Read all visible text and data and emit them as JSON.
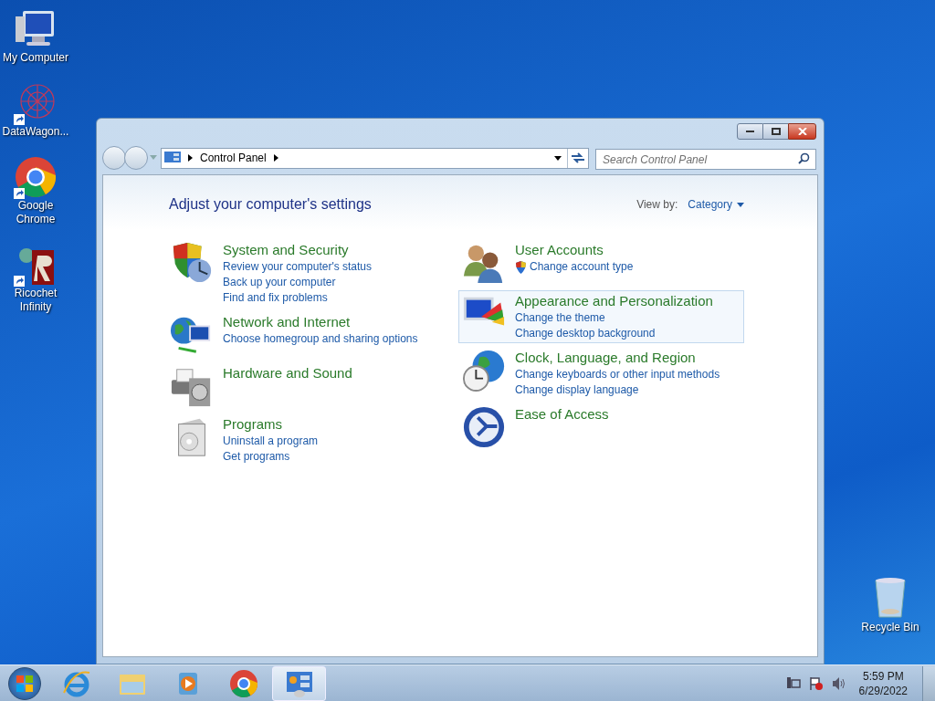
{
  "desktop_icons": [
    {
      "kind": "computer",
      "label": "My Computer",
      "shortcut": false
    },
    {
      "kind": "web",
      "label": "DataWagon...",
      "shortcut": true
    },
    {
      "kind": "browser",
      "label": "Google Chrome",
      "shortcut": true
    },
    {
      "kind": "game",
      "label": "Ricochet Infinity",
      "shortcut": true
    }
  ],
  "recycle_bin": {
    "label": "Recycle Bin"
  },
  "window": {
    "address": "Control Panel",
    "search": {
      "placeholder": "Search Control Panel"
    },
    "heading": "Adjust your computer's settings",
    "view_by": {
      "label": "View by:",
      "value": "Category"
    },
    "columns": [
      [
        {
          "kind": "security",
          "title": "System and Security",
          "hovered": false,
          "links": [
            {
              "text": "Review your computer's status",
              "shield": false
            },
            {
              "text": "Back up your computer",
              "shield": false
            },
            {
              "text": "Find and fix problems",
              "shield": false
            }
          ]
        },
        {
          "kind": "network",
          "title": "Network and Internet",
          "hovered": false,
          "links": [
            {
              "text": "Choose homegroup and sharing options",
              "shield": false
            }
          ]
        },
        {
          "kind": "hardware",
          "title": "Hardware and Sound",
          "hovered": false
        },
        {
          "kind": "programs",
          "title": "Programs",
          "hovered": false,
          "links": [
            {
              "text": "Uninstall a program",
              "shield": false
            },
            {
              "text": "Get programs",
              "shield": false
            }
          ]
        }
      ],
      [
        {
          "kind": "users",
          "title": "User Accounts",
          "hovered": false,
          "links": [
            {
              "text": "Change account type",
              "shield": true
            }
          ]
        },
        {
          "kind": "appearance",
          "title": "Appearance and Personalization",
          "hovered": true,
          "links": [
            {
              "text": "Change the theme",
              "shield": false
            },
            {
              "text": "Change desktop background",
              "shield": false
            }
          ]
        },
        {
          "kind": "clock",
          "title": "Clock, Language, and Region",
          "hovered": false,
          "links": [
            {
              "text": "Change keyboards or other input methods",
              "shield": false
            },
            {
              "text": "Change display language",
              "shield": false
            }
          ]
        },
        {
          "kind": "access",
          "title": "Ease of Access",
          "hovered": false
        }
      ]
    ]
  },
  "taskbar": {
    "items": [
      {
        "kind": "ie",
        "active": false
      },
      {
        "kind": "explorer",
        "active": false
      },
      {
        "kind": "media",
        "active": false
      },
      {
        "kind": "chrome",
        "active": false
      },
      {
        "kind": "controlpanel",
        "active": true
      }
    ],
    "time": "5:59 PM",
    "date": "6/29/2022"
  }
}
